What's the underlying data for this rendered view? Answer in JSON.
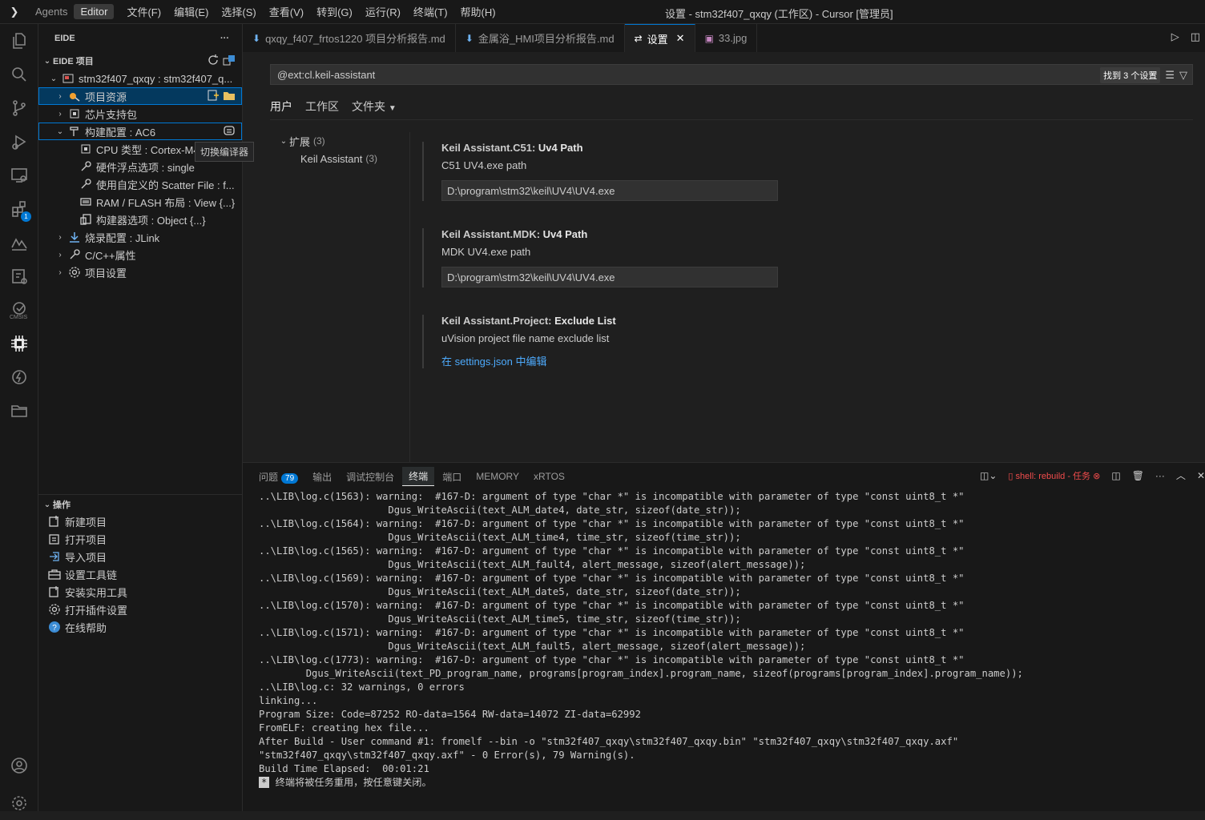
{
  "titlebar": {
    "agents": "Agents",
    "editor": "Editor",
    "menus": [
      "文件(F)",
      "编辑(E)",
      "选择(S)",
      "查看(V)",
      "转到(G)",
      "运行(R)",
      "终端(T)",
      "帮助(H)"
    ],
    "title": "设置 - stm32f407_qxqy (工作区) - Cursor [管理员]"
  },
  "sidebar": {
    "header": "EIDE",
    "more": "···",
    "section": "EIDE 项目",
    "project": "stm32f407_qxqy : stm32f407_q...",
    "items": [
      {
        "label": "项目资源"
      },
      {
        "label": "芯片支持包"
      },
      {
        "label": "构建配置 : AC6"
      },
      {
        "label": "CPU 类型 : Cortex-M4"
      },
      {
        "label": "硬件浮点选项 : single"
      },
      {
        "label": "使用自定义的 Scatter File : f..."
      },
      {
        "label": "RAM / FLASH 布局 : View {...}"
      },
      {
        "label": "构建器选项 : Object {...}"
      },
      {
        "label": "烧录配置 : JLink"
      },
      {
        "label": "C/C++属性"
      },
      {
        "label": "项目设置"
      }
    ],
    "tooltip": "切换编译器",
    "ops_header": "操作",
    "ops": [
      "新建项目",
      "打开项目",
      "导入项目",
      "设置工具链",
      "安装实用工具",
      "打开插件设置",
      "在线帮助"
    ]
  },
  "tabs": [
    {
      "label": "qxqy_f407_frtos1220 项目分析报告.md",
      "icon": "markdown-icon"
    },
    {
      "label": "金属浴_HMI项目分析报告.md",
      "icon": "markdown-icon"
    },
    {
      "label": "设置",
      "icon": "settings-icon",
      "close": "✕"
    },
    {
      "label": "33.jpg",
      "icon": "image-icon"
    }
  ],
  "settings": {
    "search_value": "@ext:cl.keil-assistant",
    "found": "找到 3 个设置",
    "scopes": [
      "用户",
      "工作区",
      "文件夹"
    ],
    "toc": {
      "group": "扩展",
      "group_count": "(3)",
      "child": "Keil Assistant",
      "child_count": "(3)"
    },
    "items": [
      {
        "prefix": "Keil Assistant.C51: ",
        "name": "Uv4 Path",
        "desc": "C51 UV4.exe path",
        "value": "D:\\program\\stm32\\keil\\UV4\\UV4.exe"
      },
      {
        "prefix": "Keil Assistant.MDK: ",
        "name": "Uv4 Path",
        "desc": "MDK UV4.exe path",
        "value": "D:\\program\\stm32\\keil\\UV4\\UV4.exe"
      },
      {
        "prefix": "Keil Assistant.Project: ",
        "name": "Exclude List",
        "desc": "uVision project file name exclude list",
        "link": "在 settings.json 中编辑"
      }
    ]
  },
  "panel": {
    "tabs": [
      "问题",
      "输出",
      "调试控制台",
      "终端",
      "端口",
      "MEMORY",
      "xRTOS"
    ],
    "problems_count": "79",
    "task_label": "shell: rebuild - 任务",
    "terminal_lines": [
      "..\\LIB\\log.c(1563): warning:  #167-D: argument of type \"char *\" is incompatible with parameter of type \"const uint8_t *\"",
      "                      Dgus_WriteAscii(text_ALM_date4, date_str, sizeof(date_str));",
      "..\\LIB\\log.c(1564): warning:  #167-D: argument of type \"char *\" is incompatible with parameter of type \"const uint8_t *\"",
      "                      Dgus_WriteAscii(text_ALM_time4, time_str, sizeof(time_str));",
      "..\\LIB\\log.c(1565): warning:  #167-D: argument of type \"char *\" is incompatible with parameter of type \"const uint8_t *\"",
      "                      Dgus_WriteAscii(text_ALM_fault4, alert_message, sizeof(alert_message));",
      "..\\LIB\\log.c(1569): warning:  #167-D: argument of type \"char *\" is incompatible with parameter of type \"const uint8_t *\"",
      "                      Dgus_WriteAscii(text_ALM_date5, date_str, sizeof(date_str));",
      "..\\LIB\\log.c(1570): warning:  #167-D: argument of type \"char *\" is incompatible with parameter of type \"const uint8_t *\"",
      "                      Dgus_WriteAscii(text_ALM_time5, time_str, sizeof(time_str));",
      "..\\LIB\\log.c(1571): warning:  #167-D: argument of type \"char *\" is incompatible with parameter of type \"const uint8_t *\"",
      "                      Dgus_WriteAscii(text_ALM_fault5, alert_message, sizeof(alert_message));",
      "..\\LIB\\log.c(1773): warning:  #167-D: argument of type \"char *\" is incompatible with parameter of type \"const uint8_t *\"",
      "        Dgus_WriteAscii(text_PD_program_name, programs[program_index].program_name, sizeof(programs[program_index].program_name));",
      "..\\LIB\\log.c: 32 warnings, 0 errors",
      "linking...",
      "Program Size: Code=87252 RO-data=1564 RW-data=14072 ZI-data=62992",
      "FromELF: creating hex file...",
      "After Build - User command #1: fromelf --bin -o \"stm32f407_qxqy\\stm32f407_qxqy.bin\" \"stm32f407_qxqy\\stm32f407_qxqy.axf\"",
      "\"stm32f407_qxqy\\stm32f407_qxqy.axf\" - 0 Error(s), 79 Warning(s).",
      "Build Time Elapsed:  00:01:21"
    ],
    "final_marker": "*",
    "final_text": " 终端将被任务重用，按任意键关闭。"
  },
  "colors": {
    "accent": "#0078d4",
    "link": "#4daafc",
    "error": "#f14c4c"
  }
}
